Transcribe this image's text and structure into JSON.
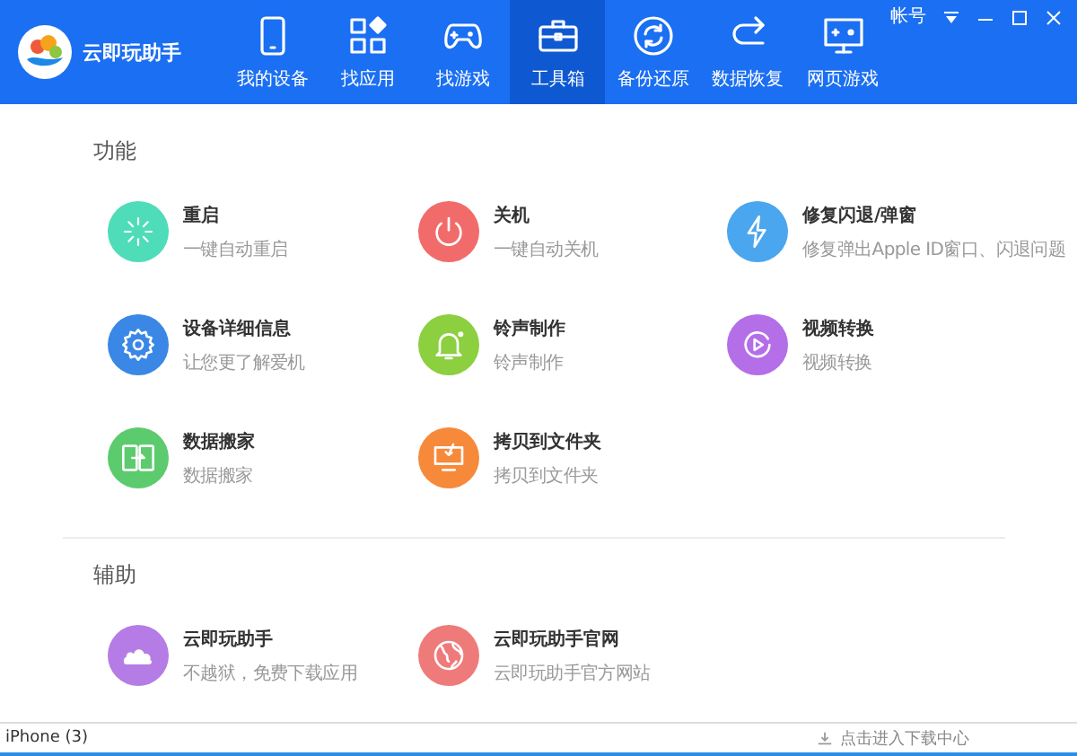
{
  "app": {
    "title": "云即玩助手"
  },
  "nav": [
    {
      "label": "我的设备",
      "kind": "phone",
      "selected": false
    },
    {
      "label": "找应用",
      "kind": "apps",
      "selected": false
    },
    {
      "label": "找游戏",
      "kind": "gamepad",
      "selected": false
    },
    {
      "label": "工具箱",
      "kind": "toolbox",
      "selected": true
    },
    {
      "label": "备份还原",
      "kind": "sync",
      "selected": false
    },
    {
      "label": "数据恢复",
      "kind": "redo",
      "selected": false
    },
    {
      "label": "网页游戏",
      "kind": "monitor",
      "selected": false
    }
  ],
  "account": "帐号",
  "sections": [
    {
      "title": "功能",
      "items": [
        {
          "title": "重启",
          "subtitle": "一键自动重启",
          "kind": "restart",
          "color": "#4fdcb8"
        },
        {
          "title": "关机",
          "subtitle": "一键自动关机",
          "kind": "power",
          "color": "#f26b6b"
        },
        {
          "title": "修复闪退/弹窗",
          "subtitle": "修复弹出Apple ID窗口、闪退问题",
          "kind": "bolt",
          "color": "#4aa6ee"
        },
        {
          "title": "设备详细信息",
          "subtitle": "让您更了解爱机",
          "kind": "gear",
          "color": "#3a87e6"
        },
        {
          "title": "铃声制作",
          "subtitle": "铃声制作",
          "kind": "bell",
          "color": "#8ccf3f"
        },
        {
          "title": "视频转换",
          "subtitle": "视频转换",
          "kind": "play",
          "color": "#b46ee8"
        },
        {
          "title": "数据搬家",
          "subtitle": "数据搬家",
          "kind": "transfer",
          "color": "#5ccb6e"
        },
        {
          "title": "拷贝到文件夹",
          "subtitle": "拷贝到文件夹",
          "kind": "copy",
          "color": "#f7893a"
        }
      ]
    },
    {
      "title": "辅助",
      "items": [
        {
          "title": "云即玩助手",
          "subtitle": "不越狱，免费下载应用",
          "kind": "cloud",
          "color": "#b57ce6"
        },
        {
          "title": "云即玩助手官网",
          "subtitle": "云即玩助手官方网站",
          "kind": "globe",
          "color": "#ee7a7a"
        }
      ]
    }
  ],
  "status_bar": {
    "device": "iPhone (3)",
    "download_center": "点击进入下载中心"
  }
}
